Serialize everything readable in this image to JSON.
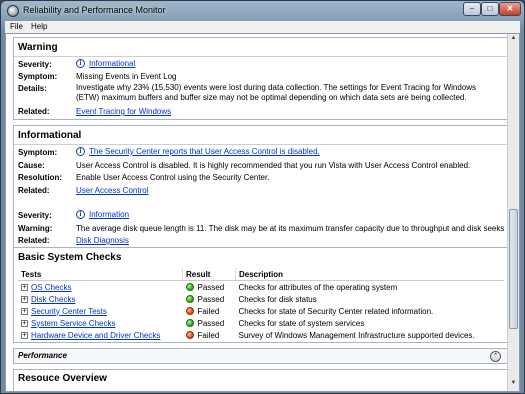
{
  "window": {
    "title": "Reliability and Performance Monitor"
  },
  "controls": {
    "minimize": "–",
    "maximize": "□",
    "close": "✕"
  },
  "menu": {
    "file": "File",
    "help": "Help"
  },
  "warning": {
    "title": "Warning",
    "severity_label": "Severity:",
    "severity_value": "Informational",
    "symptom_label": "Symptom:",
    "symptom_value": "Missing Events in Event Log",
    "details_label": "Details:",
    "details_value": "Investigate why 23% (15,530) events were lost during data collection. The settings for Event Tracing for Windows (ETW) maximum buffers and buffer size may not be optimal depending on which data sets are being collected.",
    "related_label": "Related:",
    "related_value": "Event Tracing for Windows"
  },
  "informational": {
    "title": "Informational",
    "item1": {
      "symptom_label": "Symptom:",
      "symptom_value": "The Security Center reports that User Access Control is disabled.",
      "cause_label": "Cause:",
      "cause_value": "User Access Control is disabled. It is highly recommended that you run Vista with User Access Control enabled.",
      "resolution_label": "Resolution:",
      "resolution_value": "Enable User Access Control using the Security Center.",
      "related_label": "Related:",
      "related_value": "User Access Control"
    },
    "item2": {
      "severity_label": "Severity:",
      "severity_value": "Information",
      "warning_label": "Warning:",
      "warning_value": "The average disk queue length is 11. The disk may be at its maximum transfer capacity due to throughput and disk seeks",
      "related_label": "Related:",
      "related_value": "Disk Diagnosis"
    }
  },
  "checks": {
    "title": "Basic System Checks",
    "headers": {
      "tests": "Tests",
      "result": "Result",
      "description": "Description"
    },
    "rows": [
      {
        "test": "OS Checks",
        "result": "Passed",
        "description": "Checks for attributes of the operating system"
      },
      {
        "test": "Disk Checks",
        "result": "Passed",
        "description": "Checks for disk status"
      },
      {
        "test": "Security Center Tests",
        "result": "Failed",
        "description": "Checks for state of Security Center related information."
      },
      {
        "test": "System Service Checks",
        "result": "Passed",
        "description": "Checks for state of system services"
      },
      {
        "test": "Hardware Device and Driver Checks",
        "result": "Failed",
        "description": "Survey of Windows Management Infrastructure supported devices."
      }
    ],
    "expander": "+"
  },
  "performance": {
    "title": "Performance",
    "collapse": "⌃"
  },
  "resource": {
    "title": "Resouce Overview"
  },
  "colors": {
    "passed": "#2e9a1a",
    "failed": "#d0451a",
    "link": "#0033cc"
  }
}
